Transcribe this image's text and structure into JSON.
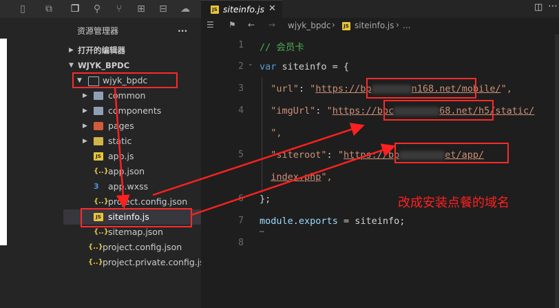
{
  "activity_icons": [
    "files-icon",
    "search-icon",
    "source-control-icon",
    "extensions-icon",
    "remote-icon",
    "docker-icon"
  ],
  "explorer": {
    "title": "资源管理器",
    "more": "···",
    "open_editors": "打开的编辑器",
    "workspace": "WJYK_BPDC",
    "root_folder": "wjyk_bpdc",
    "items": [
      {
        "label": "common",
        "type": "folder"
      },
      {
        "label": "components",
        "type": "folder"
      },
      {
        "label": "pages",
        "type": "folder"
      },
      {
        "label": "static",
        "type": "folder"
      },
      {
        "label": "app.js",
        "type": "js"
      },
      {
        "label": "app.json",
        "type": "json"
      },
      {
        "label": "app.wxss",
        "type": "css"
      },
      {
        "label": "project.config.json",
        "type": "json"
      },
      {
        "label": "siteinfo.js",
        "type": "js"
      },
      {
        "label": "sitemap.json",
        "type": "json"
      },
      {
        "label": "project.config.json",
        "type": "json"
      },
      {
        "label": "project.private.config.js...",
        "type": "json"
      }
    ]
  },
  "editor": {
    "tab_label": "siteinfo.js",
    "tab_icon": "JS",
    "breadcrumb": {
      "folder": "wjyk_bpdc",
      "file": "siteinfo.js",
      "more": "..."
    },
    "line_numbers": [
      "1",
      "2",
      "3",
      "4",
      "",
      "5",
      "",
      "6",
      "7",
      "8"
    ],
    "code": {
      "l1": "// 会员卡",
      "l2_kw": "var",
      "l2_rest": " siteinfo = {",
      "l3_key": "\"url\"",
      "l3_colon": ": ",
      "l3_q": "\"",
      "l3_url_a": "https://bp",
      "l3_url_b": "n168.net/mobile/",
      "l3_end": "\",",
      "l4_key": "\"imgUrl\"",
      "l4_url_a": "https://bpc",
      "l4_url_b": "68.net/h5/static/",
      "l4b": "\",",
      "l5_key": "\"siteroot\"",
      "l5_url_a": "https://bp",
      "l5_url_b": "et/app/",
      "l5b_url": "index.php",
      "l5b_end": "\",",
      "l6": "};",
      "l7_a": "module",
      "l7_b": ".",
      "l7_c": "exports",
      "l7_d": " = siteinfo;",
      "l7_e": "…"
    },
    "annotation": "改成安装点餐的域名"
  },
  "colors": {
    "annotation_red": "#ff2020",
    "editor_bg": "#1e1e1e"
  }
}
